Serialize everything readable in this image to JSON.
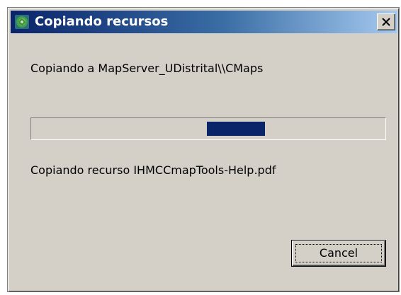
{
  "window": {
    "title": "Copiando recursos",
    "icon": "cmaptools-app-icon",
    "close_icon": "close-icon"
  },
  "status": {
    "destination_text": "Copiando a MapServer_UDistrital\\\\CMaps",
    "current_file_text": "Copiando recurso IHMCCmapTools-Help.pdf"
  },
  "progress": {
    "style": "indeterminate-marquee",
    "chunk_color": "#0a246a"
  },
  "buttons": {
    "cancel_label": "Cancel"
  },
  "colors": {
    "dialog_bg": "#d4d0c8",
    "title_gradient_start": "#0a246a",
    "title_gradient_end": "#a6caf0",
    "title_text": "#ffffff"
  }
}
